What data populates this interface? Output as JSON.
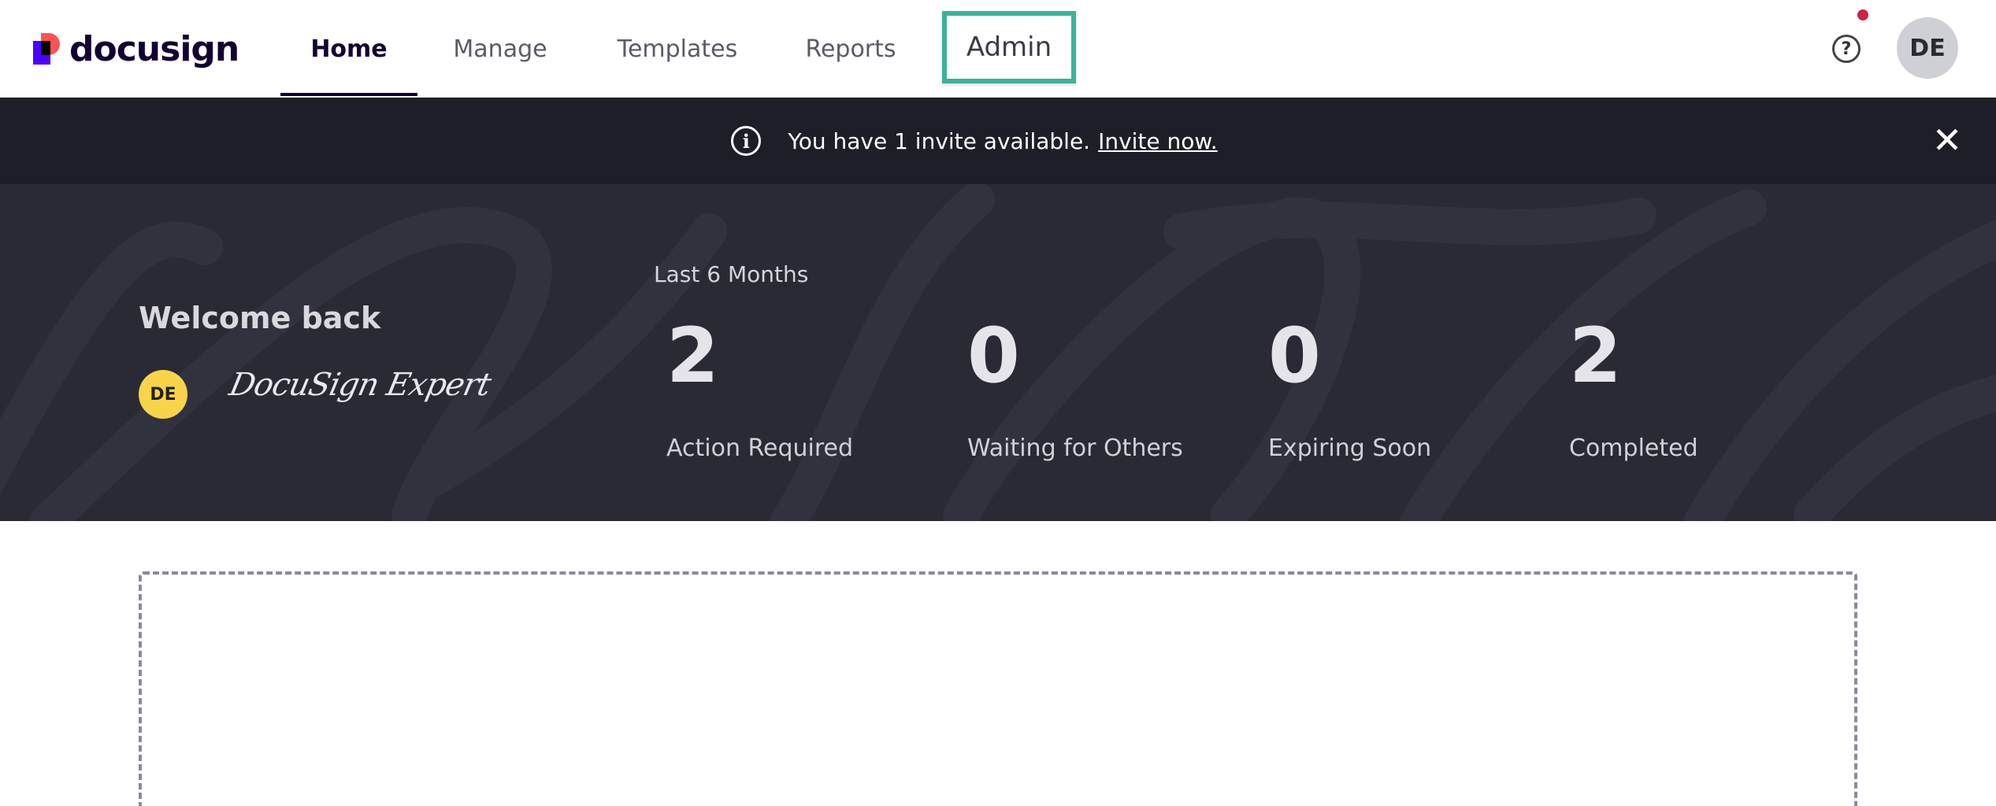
{
  "brand": {
    "name": "docusign"
  },
  "nav": {
    "items": [
      {
        "label": "Home"
      },
      {
        "label": "Manage"
      },
      {
        "label": "Templates"
      },
      {
        "label": "Reports"
      },
      {
        "label": "Admin"
      }
    ],
    "help_icon": "question-circle-icon",
    "user_initials": "DE"
  },
  "banner": {
    "text": "You have 1 invite available.",
    "link": "Invite now.",
    "info_icon": "info-icon",
    "close_icon": "close-icon"
  },
  "hero": {
    "welcome": "Welcome back",
    "user_initials": "DE",
    "signature": "DocuSign Expert",
    "period": "Last 6 Months",
    "stats": [
      {
        "value": "2",
        "label": "Action Required"
      },
      {
        "value": "0",
        "label": "Waiting for Others"
      },
      {
        "value": "0",
        "label": "Expiring Soon"
      },
      {
        "value": "2",
        "label": "Completed"
      }
    ]
  },
  "colors": {
    "highlight": "#3cb39a",
    "banner_bg": "#1e1e28",
    "hero_bg": "#2a2a35",
    "avatar_yellow": "#f7d44a",
    "notification": "#cf2240"
  }
}
